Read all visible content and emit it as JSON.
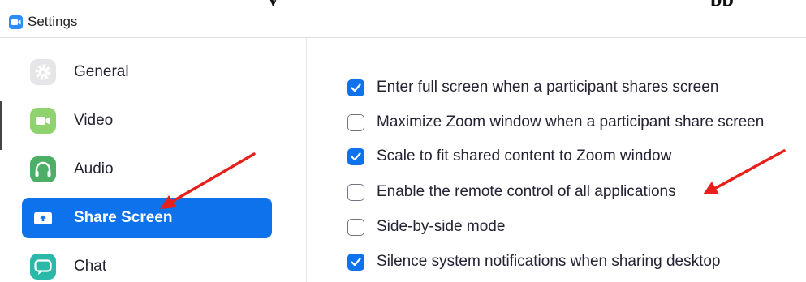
{
  "article_heading_fragment": [
    "y",
    "pp"
  ],
  "window": {
    "title": "Settings",
    "icon": "zoom-camera-icon"
  },
  "sidebar": {
    "items": [
      {
        "label": "General",
        "icon": "gear-icon",
        "icon_color": "#e6e6e8",
        "active": false
      },
      {
        "label": "Video",
        "icon": "video-camera-icon",
        "icon_color": "#8ed36f",
        "active": false
      },
      {
        "label": "Audio",
        "icon": "headphones-icon",
        "icon_color": "#4caf65",
        "active": false
      },
      {
        "label": "Share Screen",
        "icon": "share-screen-icon",
        "icon_color": "#0e72ed",
        "active": true
      },
      {
        "label": "Chat",
        "icon": "chat-bubble-icon",
        "icon_color": "#2ab8a8",
        "active": false
      }
    ]
  },
  "share_screen": {
    "options": [
      {
        "label": "Enter full screen when a participant shares screen",
        "checked": true
      },
      {
        "label": "Maximize Zoom window when a participant share screen",
        "checked": false
      },
      {
        "label": "Scale to fit shared content to Zoom window",
        "checked": true
      },
      {
        "label": "Enable the remote control of all applications",
        "checked": false
      },
      {
        "label": "Side-by-side mode",
        "checked": false
      },
      {
        "label": "Silence system notifications when sharing desktop",
        "checked": true
      }
    ]
  },
  "colors": {
    "accent": "#0e72ed",
    "annotation_arrow": "#e8201c",
    "text": "#232333"
  }
}
